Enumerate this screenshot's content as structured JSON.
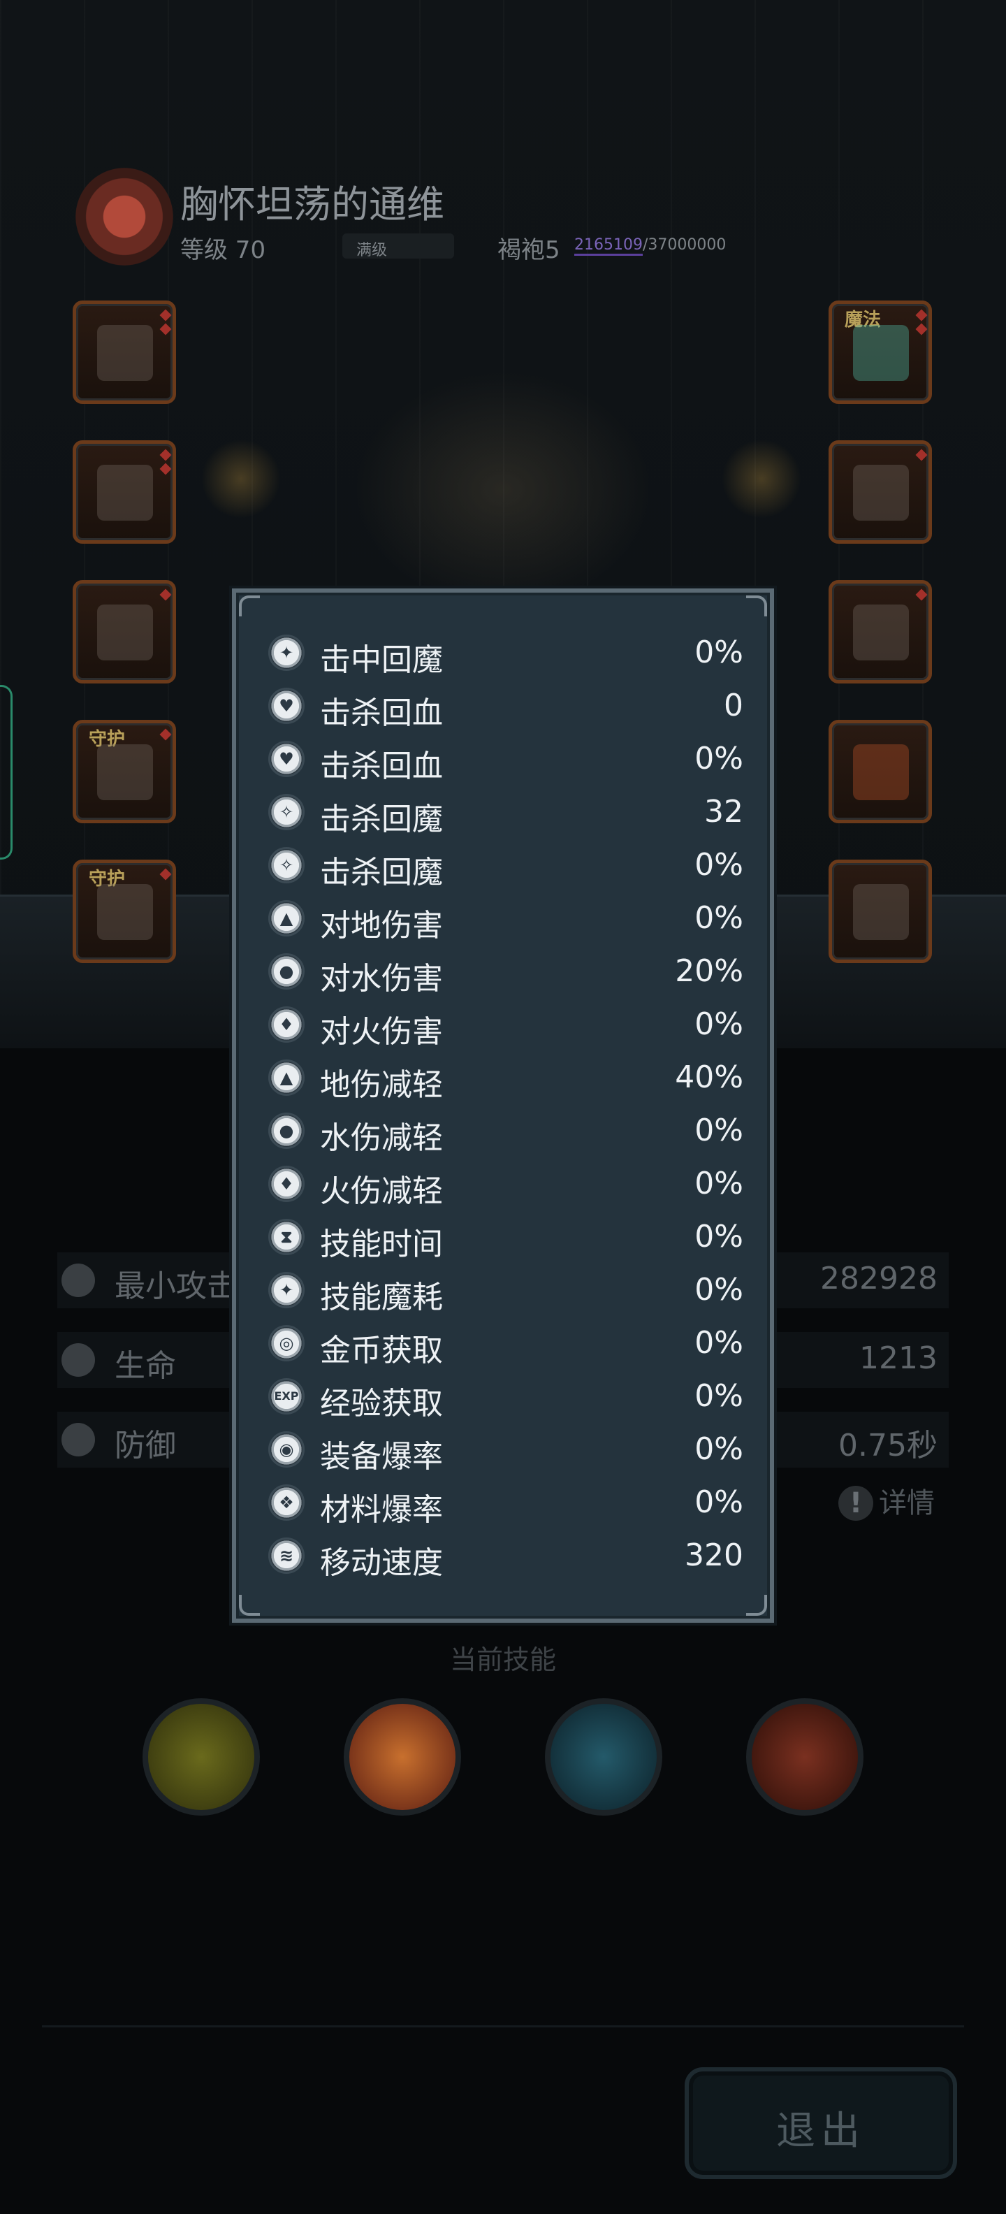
{
  "hero": {
    "name": "胸怀坦荡的通维",
    "level": "等级 70",
    "level_badge": "满级",
    "class": "褐袍5",
    "exp_current": "2165109",
    "exp_max": "/37000000"
  },
  "equipment": {
    "left": [
      {
        "tag": ""
      },
      {
        "tag": ""
      },
      {
        "tag": ""
      },
      {
        "tag": "守护"
      },
      {
        "tag": "守护"
      }
    ],
    "right": [
      {
        "tag": "魔法"
      },
      {
        "tag": ""
      },
      {
        "tag": ""
      },
      {
        "tag": ""
      },
      {
        "tag": ""
      }
    ]
  },
  "stats": [
    {
      "label": "最小攻击",
      "value": "282928",
      "icon": "sword-icon"
    },
    {
      "label": "生命",
      "value": "1213",
      "icon": "heart-icon"
    },
    {
      "label": "防御",
      "value": "0.75秒",
      "icon": "shield-icon"
    }
  ],
  "detail_label": "详情",
  "skills_title": "当前技能",
  "skills": [
    {
      "name": "yellow-orbs-skill-icon",
      "color": "#8a8a22"
    },
    {
      "name": "explosion-skill-icon",
      "color": "#b4452a"
    },
    {
      "name": "water-shield-skill-icon",
      "color": "#1e5b6e"
    },
    {
      "name": "crossed-axes-skill-icon",
      "color": "#8a2e1e"
    }
  ],
  "exit_label": "退出",
  "attributes": [
    {
      "label": "击中回魔",
      "value": "0%",
      "icon": "hit-mana-icon"
    },
    {
      "label": "击杀回血",
      "value": "0",
      "icon": "kill-heal-icon"
    },
    {
      "label": "击杀回血",
      "value": "0%",
      "icon": "kill-heal-percent-icon"
    },
    {
      "label": "击杀回魔",
      "value": "32",
      "icon": "kill-mana-icon"
    },
    {
      "label": "击杀回魔",
      "value": "0%",
      "icon": "kill-mana-percent-icon"
    },
    {
      "label": "对地伤害",
      "value": "0%",
      "icon": "earth-damage-icon"
    },
    {
      "label": "对水伤害",
      "value": "20%",
      "icon": "water-damage-icon"
    },
    {
      "label": "对火伤害",
      "value": "0%",
      "icon": "fire-damage-icon"
    },
    {
      "label": "地伤减轻",
      "value": "40%",
      "icon": "earth-resist-icon"
    },
    {
      "label": "水伤减轻",
      "value": "0%",
      "icon": "water-resist-icon"
    },
    {
      "label": "火伤减轻",
      "value": "0%",
      "icon": "fire-resist-icon"
    },
    {
      "label": "技能时间",
      "value": "0%",
      "icon": "hourglass-icon"
    },
    {
      "label": "技能魔耗",
      "value": "0%",
      "icon": "skill-mana-cost-icon"
    },
    {
      "label": "金币获取",
      "value": "0%",
      "icon": "gold-coin-icon"
    },
    {
      "label": "经验获取",
      "value": "0%",
      "icon": "exp-icon"
    },
    {
      "label": "装备爆率",
      "value": "0%",
      "icon": "equipment-drop-icon"
    },
    {
      "label": "材料爆率",
      "value": "0%",
      "icon": "material-drop-icon"
    },
    {
      "label": "移动速度",
      "value": "320",
      "icon": "boot-speed-icon"
    }
  ]
}
